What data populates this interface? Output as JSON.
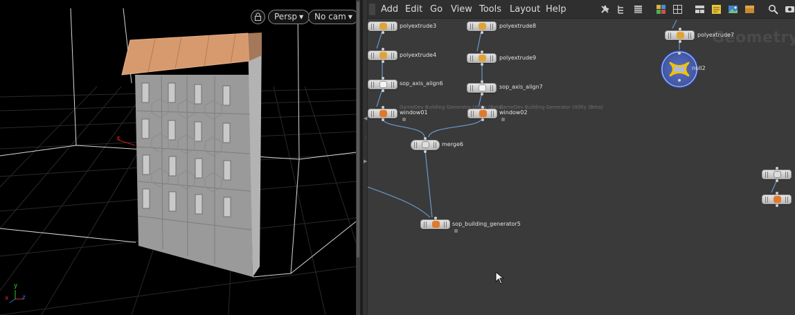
{
  "viewport": {
    "camera_menu": "Persp",
    "cam_menu": "No cam",
    "axis_labels": {
      "x": "x",
      "y": "y",
      "z": "z"
    }
  },
  "network": {
    "menu": [
      "Add",
      "Edit",
      "Go",
      "View",
      "Tools",
      "Layout",
      "Help"
    ],
    "context_watermark": "Geometry",
    "toolbar_icons": [
      "wrench-icon",
      "tree-icon",
      "list-icon",
      "grid-color-icon",
      "grid-icon",
      "tiles-icon",
      "sticky-note-icon",
      "image-icon",
      "package-icon",
      "search-icon",
      "eye-icon"
    ],
    "nodes": {
      "polyextrude3": "polyextrude3",
      "polyextrude8": "polyextrude8",
      "polyextrude7": "polyextrude7",
      "polyextrude4": "polyextrude4",
      "polyextrude9": "polyextrude9",
      "sop_axis_align6": "sop_axis_align6",
      "sop_axis_align7": "sop_axis_align7",
      "window01": "window01",
      "window02": "window02",
      "window_subtitle": "GameDev Building Generator Utility (Beta)",
      "merge6": "merge6",
      "null2": "null2",
      "sop_building_generator5": "sop_building_generator5"
    },
    "icon_colors": {
      "polyextrude": "#e0a33a",
      "window": "#e07a2a",
      "building_generator": "#e07a2a",
      "null_ring": "#f2c200",
      "null_center": "#a7b9f0"
    }
  }
}
